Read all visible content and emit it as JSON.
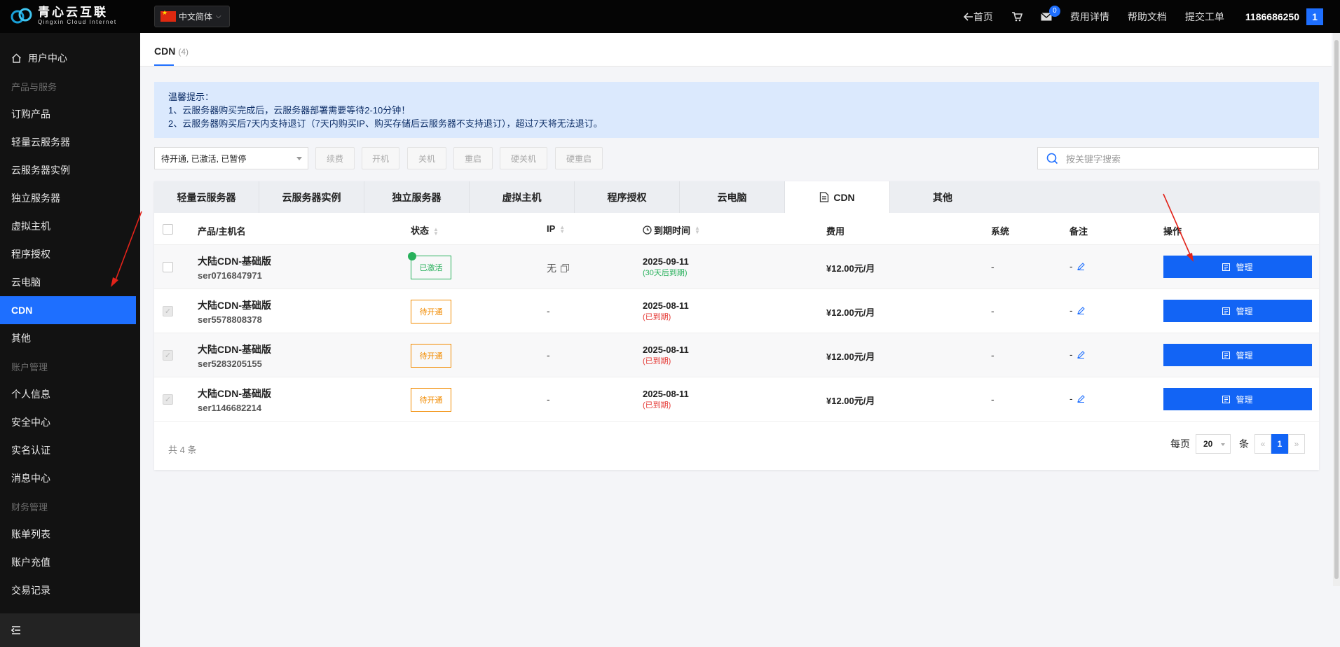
{
  "header": {
    "logo_cn": "青心云互联",
    "logo_en": "Qingxin Cloud Internet",
    "language": "中文简体",
    "nav": {
      "home": "首页",
      "mail_badge": "0",
      "fee_detail": "费用详情",
      "help_docs": "帮助文档",
      "submit_ticket": "提交工单"
    },
    "user_id": "1186686250",
    "user_num": "1"
  },
  "sidebar": {
    "items": [
      {
        "label": "用户中心",
        "type": "home"
      },
      {
        "label": "产品与服务",
        "type": "group"
      },
      {
        "label": "订购产品"
      },
      {
        "label": "轻量云服务器"
      },
      {
        "label": "云服务器实例"
      },
      {
        "label": "独立服务器"
      },
      {
        "label": "虚拟主机"
      },
      {
        "label": "程序授权"
      },
      {
        "label": "云电脑"
      },
      {
        "label": "CDN",
        "type": "active"
      },
      {
        "label": "其他"
      },
      {
        "label": "账户管理",
        "type": "group"
      },
      {
        "label": "个人信息"
      },
      {
        "label": "安全中心"
      },
      {
        "label": "实名认证"
      },
      {
        "label": "消息中心"
      },
      {
        "label": "财务管理",
        "type": "group"
      },
      {
        "label": "账单列表"
      },
      {
        "label": "账户充值"
      },
      {
        "label": "交易记录"
      }
    ]
  },
  "page": {
    "tab_title": "CDN",
    "tab_count": "(4)"
  },
  "notice": {
    "title": "温馨提示：",
    "line1": "1、云服务器购买完成后，云服务器部署需要等待2-10分钟！",
    "line2": "2、云服务器购买后7天内支持退订（7天内购买IP、购买存储后云服务器不支持退订），超过7天将无法退订。"
  },
  "toolbar": {
    "status_filter": "待开通, 已激活, 已暂停",
    "buttons": [
      "续费",
      "开机",
      "关机",
      "重启",
      "硬关机",
      "硬重启"
    ],
    "search_placeholder": "按关键字搜索"
  },
  "category_tabs": [
    "轻量云服务器",
    "云服务器实例",
    "独立服务器",
    "虚拟主机",
    "程序授权",
    "云电脑",
    "CDN",
    "其他"
  ],
  "active_category": "CDN",
  "table": {
    "columns": [
      "产品/主机名",
      "状态",
      "IP",
      "到期时间",
      "费用",
      "系统",
      "备注",
      "操作"
    ],
    "rows": [
      {
        "name": "大陆CDN-基础版",
        "host": "ser0716847971",
        "status": "已激活",
        "status_type": "active",
        "ip": "无",
        "expire": "2025-09-11",
        "expire_note": "(30天后到期)",
        "expire_type": "ok",
        "fee": "¥12.00元/月",
        "system": "-",
        "remark": "-",
        "action": "管理"
      },
      {
        "name": "大陆CDN-基础版",
        "host": "ser5578808378",
        "status": "待开通",
        "status_type": "pending",
        "ip": "-",
        "expire": "2025-08-11",
        "expire_note": "(已到期)",
        "expire_type": "expired",
        "fee": "¥12.00元/月",
        "system": "-",
        "remark": "-",
        "action": "管理"
      },
      {
        "name": "大陆CDN-基础版",
        "host": "ser5283205155",
        "status": "待开通",
        "status_type": "pending",
        "ip": "-",
        "expire": "2025-08-11",
        "expire_note": "(已到期)",
        "expire_type": "expired",
        "fee": "¥12.00元/月",
        "system": "-",
        "remark": "-",
        "action": "管理"
      },
      {
        "name": "大陆CDN-基础版",
        "host": "ser1146682214",
        "status": "待开通",
        "status_type": "pending",
        "ip": "-",
        "expire": "2025-08-11",
        "expire_note": "(已到期)",
        "expire_type": "expired",
        "fee": "¥12.00元/月",
        "system": "-",
        "remark": "-",
        "action": "管理"
      }
    ]
  },
  "footer": {
    "total": "共 4 条",
    "per_page_label": "每页",
    "per_page": "20",
    "unit": "条",
    "prev": "«",
    "current_page": "1",
    "next": "»"
  },
  "colors": {
    "accent": "#1e6fff",
    "active_status": "#27b05b",
    "pending_status": "#f28b00",
    "expired": "#e53935"
  }
}
